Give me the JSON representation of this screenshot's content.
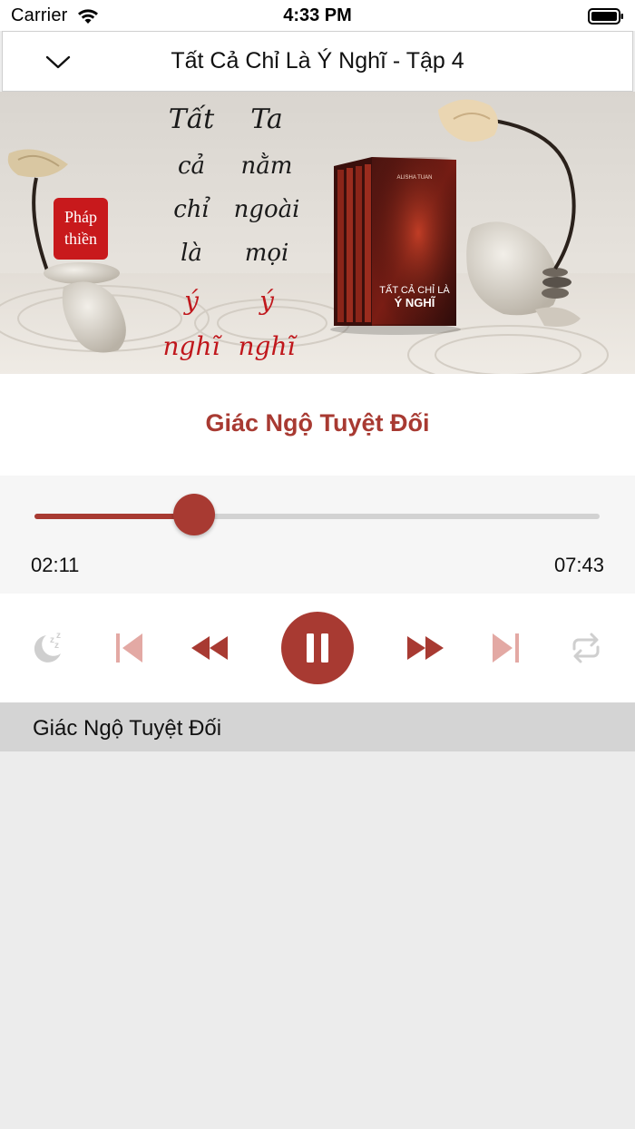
{
  "status_bar": {
    "carrier": "Carrier",
    "time": "4:33 PM",
    "wifi_icon": "wifi-icon",
    "battery_icon": "battery-icon"
  },
  "nav": {
    "title": "Tất Cả Chỉ Là Ý Nghĩ - Tập 4",
    "back_icon": "chevron-down-icon"
  },
  "banner": {
    "badge": [
      "Pháp",
      "thiền"
    ],
    "calligraphy_left": [
      "Tất",
      "cả",
      "chỉ",
      "là",
      "ý",
      "nghĩ"
    ],
    "calligraphy_right": [
      "Ta",
      "nằm",
      "ngoài",
      "mọi",
      "ý",
      "nghĩ"
    ],
    "book_title": [
      "TẤT CẢ CHỈ LÀ",
      "Ý NGHĨ"
    ],
    "book_author": "ALISHA TUAN"
  },
  "player": {
    "track_title": "Giác Ngộ Tuyệt Đối",
    "elapsed": "02:11",
    "duration": "07:43",
    "progress": 0.2829
  },
  "controls": {
    "sleep_icon": "sleep-timer-icon",
    "prev_icon": "skip-previous-icon",
    "rewind_icon": "rewind-icon",
    "pause_icon": "pause-icon",
    "forward_icon": "fast-forward-icon",
    "next_icon": "skip-next-icon",
    "repeat_icon": "repeat-icon"
  },
  "playlist": {
    "items": [
      {
        "label": "Giác Ngộ Tuyệt Đối"
      }
    ]
  },
  "colors": {
    "accent": "#a83a32",
    "accent_light": "#e3a9a4",
    "inactive": "#cfcfcf"
  }
}
